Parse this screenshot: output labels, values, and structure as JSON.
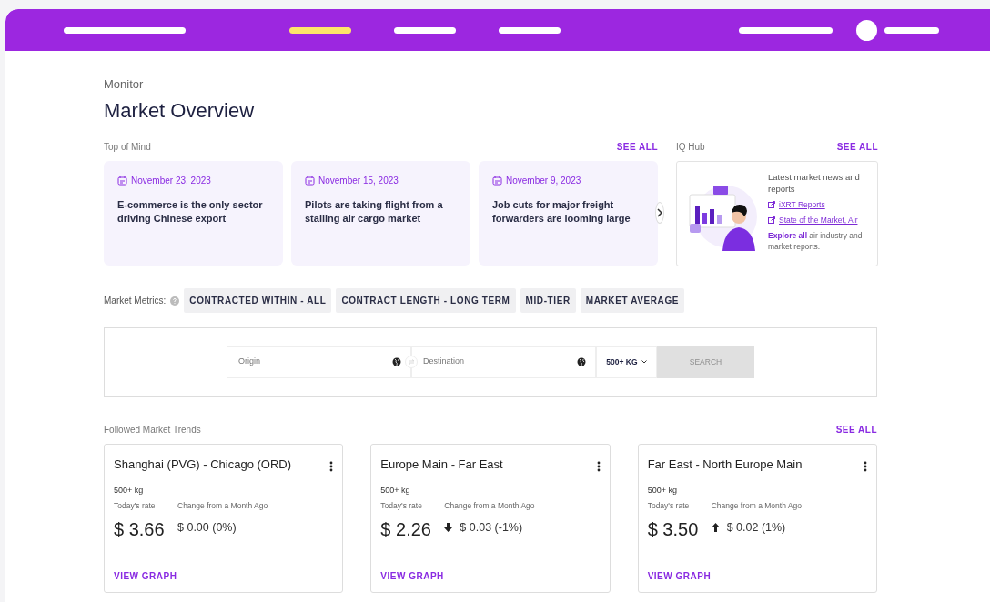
{
  "nav": {
    "items": [
      {
        "selected": false
      },
      {
        "selected": true
      },
      {
        "selected": false
      },
      {
        "selected": false
      }
    ]
  },
  "header": {
    "eyebrow": "Monitor",
    "title": "Market Overview"
  },
  "top_of_mind": {
    "label": "Top of Mind",
    "see_all": "SEE ALL",
    "articles": [
      {
        "date": "November 23, 2023",
        "title": "E-commerce is the only sector driving Chinese export"
      },
      {
        "date": "November 15, 2023",
        "title": "Pilots are taking flight from a stalling air cargo market"
      },
      {
        "date": "November 9, 2023",
        "title": "Job cuts for major freight forwarders are looming large"
      }
    ]
  },
  "iq_hub": {
    "label": "IQ Hub",
    "see_all": "SEE ALL",
    "heading": "Latest market news and reports",
    "links": [
      "iXRT Reports",
      "State of the Market, Air"
    ],
    "explore_link": "Explore all",
    "explore_text": "air industry and market reports."
  },
  "market_metrics": {
    "label": "Market Metrics:",
    "chips": [
      "CONTRACTED WITHIN - ALL",
      "CONTRACT LENGTH - LONG TERM",
      "MID-TIER",
      "MARKET AVERAGE"
    ]
  },
  "search": {
    "origin_placeholder": "Origin",
    "destination_placeholder": "Destination",
    "weight": "500+ KG",
    "button": "SEARCH",
    "disabled": true
  },
  "trends": {
    "label": "Followed Market Trends",
    "see_all": "SEE ALL",
    "cards": [
      {
        "title": "Shanghai (PVG) - Chicago (ORD)",
        "weight": "500+ kg",
        "rate_label": "Today's rate",
        "change_label": "Change from a Month Ago",
        "rate": "$ 3.66",
        "change": "$ 0.00 (0%)",
        "kind": "none",
        "link": "VIEW GRAPH"
      },
      {
        "title": "Europe Main - Far East",
        "weight": "500+ kg",
        "rate_label": "Today's rate",
        "change_label": "Change from a Month Ago",
        "rate": "$ 2.26",
        "change": "$ 0.03 (-1%)",
        "kind": "down",
        "link": "VIEW GRAPH"
      },
      {
        "title": "Far East - North Europe Main",
        "weight": "500+ kg",
        "rate_label": "Today's rate",
        "change_label": "Change from a Month Ago",
        "rate": "$ 3.50",
        "change": "$ 0.02 (1%)",
        "kind": "up",
        "link": "VIEW GRAPH"
      }
    ]
  }
}
